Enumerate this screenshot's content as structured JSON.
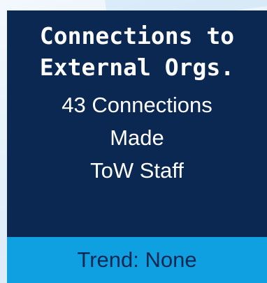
{
  "card": {
    "title_line1": "Connections to",
    "title_line2": "External Orgs.",
    "detail_line1": "43 Connections",
    "detail_line2": "Made",
    "detail_line3": "ToW Staff",
    "trend": "Trend: None",
    "colors": {
      "card_background": "#0a2852",
      "trend_background": "#0fa0e2",
      "text": "#ffffff"
    }
  }
}
